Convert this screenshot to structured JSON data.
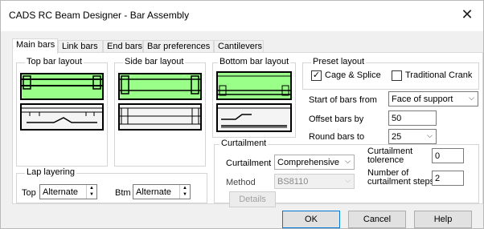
{
  "window": {
    "title": "CADS RC Beam Designer - Bar Assembly",
    "close_symbol": "✕"
  },
  "tabs": [
    {
      "label": "Main bars",
      "active": true
    },
    {
      "label": "Link bars"
    },
    {
      "label": "End bars"
    },
    {
      "label": "Bar preferences"
    },
    {
      "label": "Cantilevers"
    }
  ],
  "groups": {
    "top_bar_layout": "Top bar layout",
    "side_bar_layout": "Side bar layout",
    "bottom_bar_layout": "Bottom bar layout",
    "preset_layout": "Preset layout",
    "lap_layering": "Lap layering",
    "curtailment": "Curtailment"
  },
  "preset": {
    "cage_splice_label": "Cage & Splice",
    "cage_splice_checked": true,
    "traditional_crank_label": "Traditional Crank",
    "traditional_crank_checked": false,
    "start_of_bars_label": "Start of bars from",
    "start_of_bars_value": "Face of support",
    "offset_label": "Offset bars by",
    "offset_value": "50",
    "round_label": "Round bars to",
    "round_value": "25"
  },
  "lap": {
    "top_label": "Top",
    "top_value": "Alternate",
    "btm_label": "Btm",
    "btm_value": "Alternate"
  },
  "curtailment": {
    "curtailment_label": "Curtailment",
    "curtailment_value": "Comprehensive",
    "method_label": "Method",
    "method_value": "BS8110",
    "tolerence_label_1": "Curtailment",
    "tolerence_label_2": "tolerence",
    "tolerence_value": "0",
    "steps_label_1": "Number of",
    "steps_label_2": "curtailment steps",
    "steps_value": "2",
    "details_label": "Details"
  },
  "buttons": {
    "ok": "OK",
    "cancel": "Cancel",
    "help": "Help"
  },
  "colors": {
    "selected_fill": "#99ff88",
    "border": "#000000"
  }
}
